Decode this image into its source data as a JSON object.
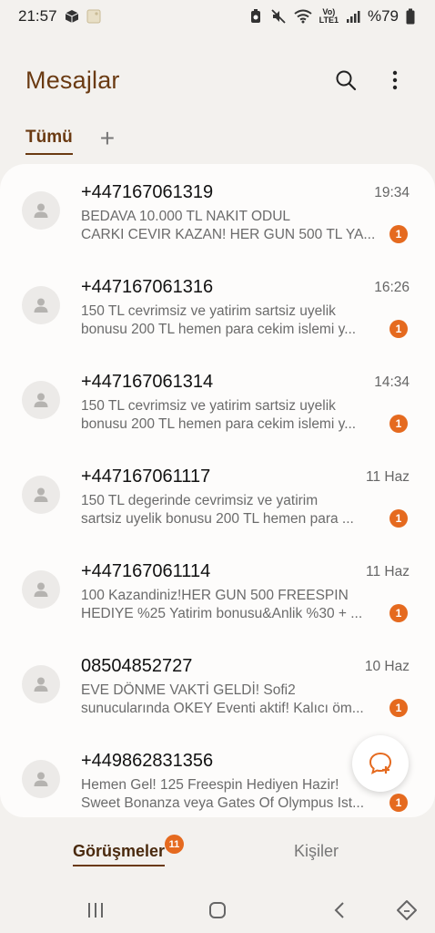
{
  "status_bar": {
    "time": "21:57",
    "battery": "%79",
    "volte_label_top": "Vo)",
    "volte_label_bottom": "LTE1",
    "icons": [
      "cube-icon",
      "image-icon",
      "alarm-icon",
      "mute-icon",
      "wifi-icon",
      "signal-icon",
      "battery-icon"
    ]
  },
  "header": {
    "title": "Mesajlar",
    "search_icon": "search-icon",
    "more_icon": "more-vertical-icon"
  },
  "filter_tabs": {
    "active": "Tümü",
    "add": "+"
  },
  "messages": [
    {
      "sender": "+447167061319",
      "time": "19:34",
      "preview_line1": "BEDAVA 10.000 TL NAKIT ODUL",
      "preview_line2": "CARKI CEVIR KAZAN! HER GUN 500 TL YA...",
      "unread": "1"
    },
    {
      "sender": "+447167061316",
      "time": "16:26",
      "preview_line1": "150 TL cevrimsiz ve yatirim sartsiz uyelik",
      "preview_line2": "bonusu 200 TL hemen para cekim islemi y...",
      "unread": "1"
    },
    {
      "sender": "+447167061314",
      "time": "14:34",
      "preview_line1": "150 TL cevrimsiz ve yatirim sartsiz uyelik",
      "preview_line2": "bonusu 200 TL hemen para cekim islemi y...",
      "unread": "1"
    },
    {
      "sender": "+447167061117",
      "time": "11 Haz",
      "preview_line1": "150 TL  degerinde cevrimsiz ve yatirim",
      "preview_line2": "sartsiz uyelik bonusu  200 TL hemen para ...",
      "unread": "1"
    },
    {
      "sender": "+447167061114",
      "time": "11 Haz",
      "preview_line1": "100 Kazandiniz!HER GUN 500 FREESPIN",
      "preview_line2": "HEDIYE %25 Yatirim bonusu&Anlik %30 + ...",
      "unread": "1"
    },
    {
      "sender": "08504852727",
      "time": "10 Haz",
      "preview_line1": "EVE DÖNME VAKTİ GELDİ! Sofi2",
      "preview_line2": "sunucularında OKEY Eventi aktif! Kalıcı öm...",
      "unread": "1"
    },
    {
      "sender": "+449862831356",
      "time": "",
      "preview_line1": "Hemen Gel! 125 Freespin Hediyen Hazir!",
      "preview_line2": "Sweet Bonanza veya Gates Of Olympus Ist...",
      "unread": "1"
    }
  ],
  "fab": {
    "icon": "new-message-icon"
  },
  "bottom_tabs": {
    "conversations": "Görüşmeler",
    "conversations_badge": "11",
    "contacts": "Kişiler"
  },
  "colors": {
    "accent_brown": "#6a3a12",
    "badge_orange": "#e56a1f",
    "background": "#f3f1ee",
    "card": "#fdfcfb"
  }
}
